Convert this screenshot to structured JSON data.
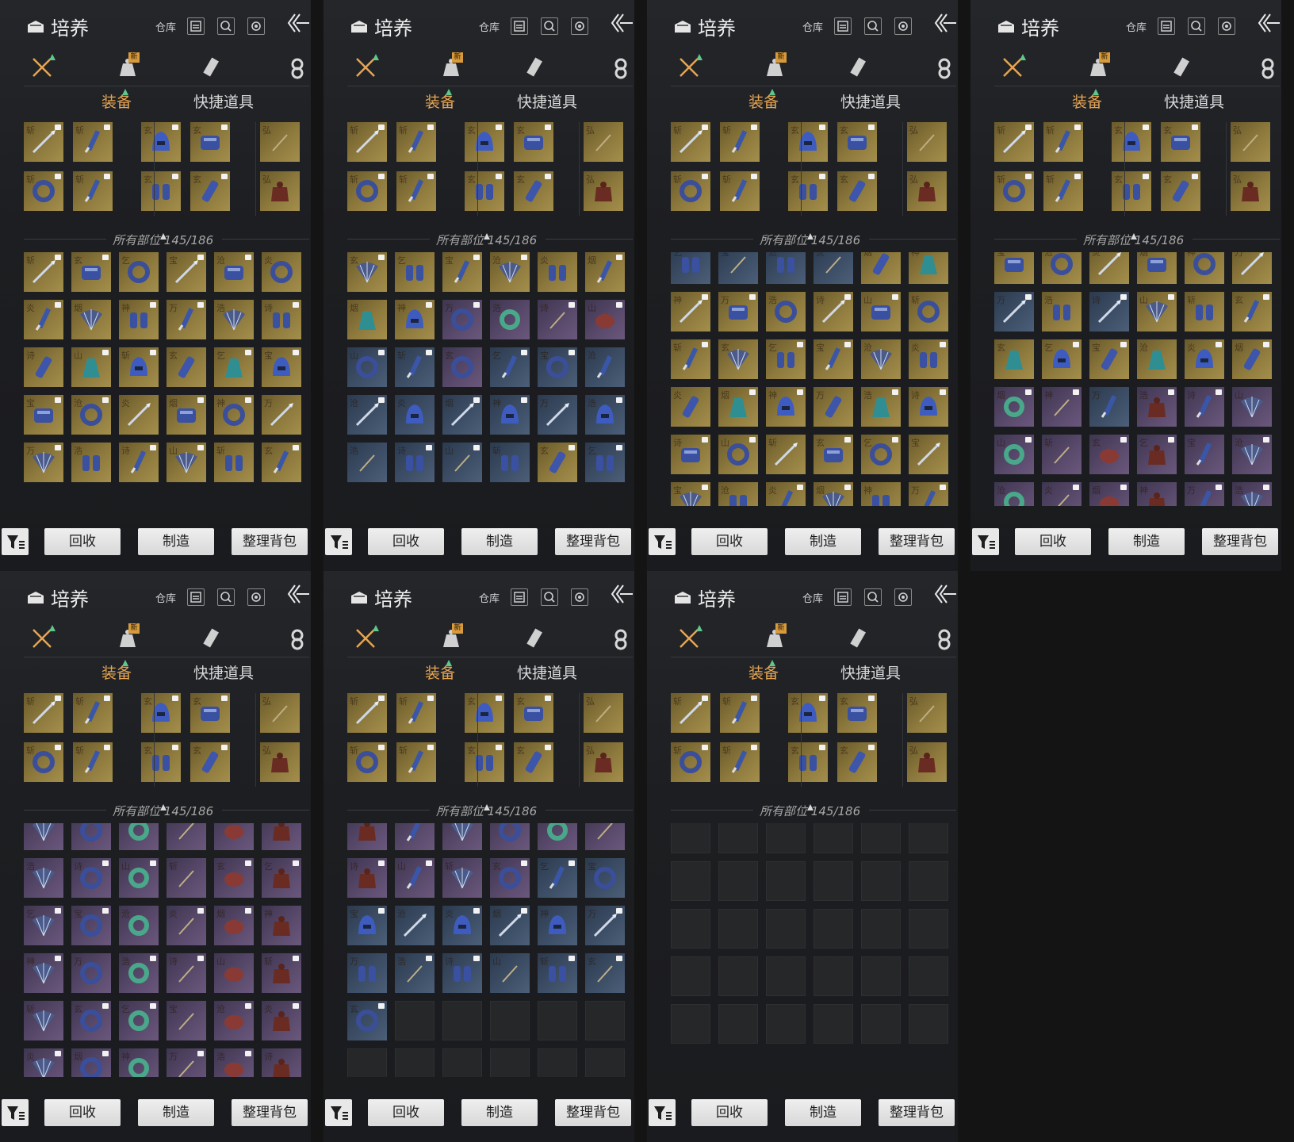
{
  "header": {
    "title": "培养",
    "warehouse": "仓库"
  },
  "category_tabs": [
    {
      "icon": "crossed-swords-icon"
    },
    {
      "icon": "pouch-icon",
      "badge": "新"
    },
    {
      "icon": "scroll-icon"
    },
    {
      "icon": "portrait-icon"
    }
  ],
  "subtabs": [
    "装备",
    "快捷道具"
  ],
  "section": {
    "label": "所有部位",
    "count": "145/186"
  },
  "footer": {
    "recycle": "回收",
    "craft": "制造",
    "sort": "整理背包"
  },
  "equipped": [
    {
      "ch": "斩",
      "q": "gold",
      "icon": "spear",
      "tag": true
    },
    {
      "ch": "斩",
      "q": "gold",
      "icon": "blade",
      "tag": true
    },
    {
      "ch": "玄",
      "q": "gold",
      "icon": "helm",
      "tag": true
    },
    {
      "ch": "玄",
      "q": "gold",
      "icon": "armor",
      "tag": true
    },
    {
      "ch": "弘",
      "q": "gold",
      "icon": "needle",
      "tag": false
    },
    {
      "ch": "斩",
      "q": "gold",
      "icon": "ring",
      "tag": true
    },
    {
      "ch": "斩",
      "q": "gold",
      "icon": "blade",
      "tag": true
    },
    {
      "ch": "玄",
      "q": "gold",
      "icon": "gauntlet",
      "tag": true
    },
    {
      "ch": "玄",
      "q": "gold",
      "icon": "greave",
      "tag": true
    },
    {
      "ch": "弘",
      "q": "gold",
      "icon": "pouch",
      "tag": false
    }
  ],
  "panels": [
    {
      "offset": 0,
      "rows": [
        "gggggg",
        "gggggg",
        "gggggg",
        "gggggg",
        "gggggg"
      ]
    },
    {
      "offset": 0,
      "rows": [
        "gggggg",
        "ggpppp",
        "bbpbbb",
        "bbbbbb",
        "bbbbgb"
      ]
    },
    {
      "offset": -10,
      "rows": [
        "bbbbgg",
        "gggggg",
        "gggggg",
        "gggggg",
        "gggggg",
        "gggggg"
      ]
    },
    {
      "offset": -10,
      "rows": [
        "gggggg",
        "bgbggg",
        "gggggg",
        "ppbppp",
        "pppppp",
        "pppppp"
      ]
    },
    {
      "offset": -16,
      "rows": [
        "pppppp",
        "pppppp",
        "pppppp",
        "pppppp",
        "pppppp",
        "pppppp"
      ]
    },
    {
      "offset": -16,
      "rows": [
        "pppppp",
        "ppppbb",
        "bbbbbb",
        "bbbbbb",
        "beeeee",
        "eeeeee"
      ]
    },
    {
      "offset": -12,
      "rows": [
        "eeeeee",
        "eeeeee",
        "eeeeee",
        "eeeeee",
        "eeeeee"
      ]
    }
  ],
  "colors": {
    "accent": "#e6a552",
    "new_badge": "#d89a3a",
    "up_arrow": "#5ec88c"
  }
}
